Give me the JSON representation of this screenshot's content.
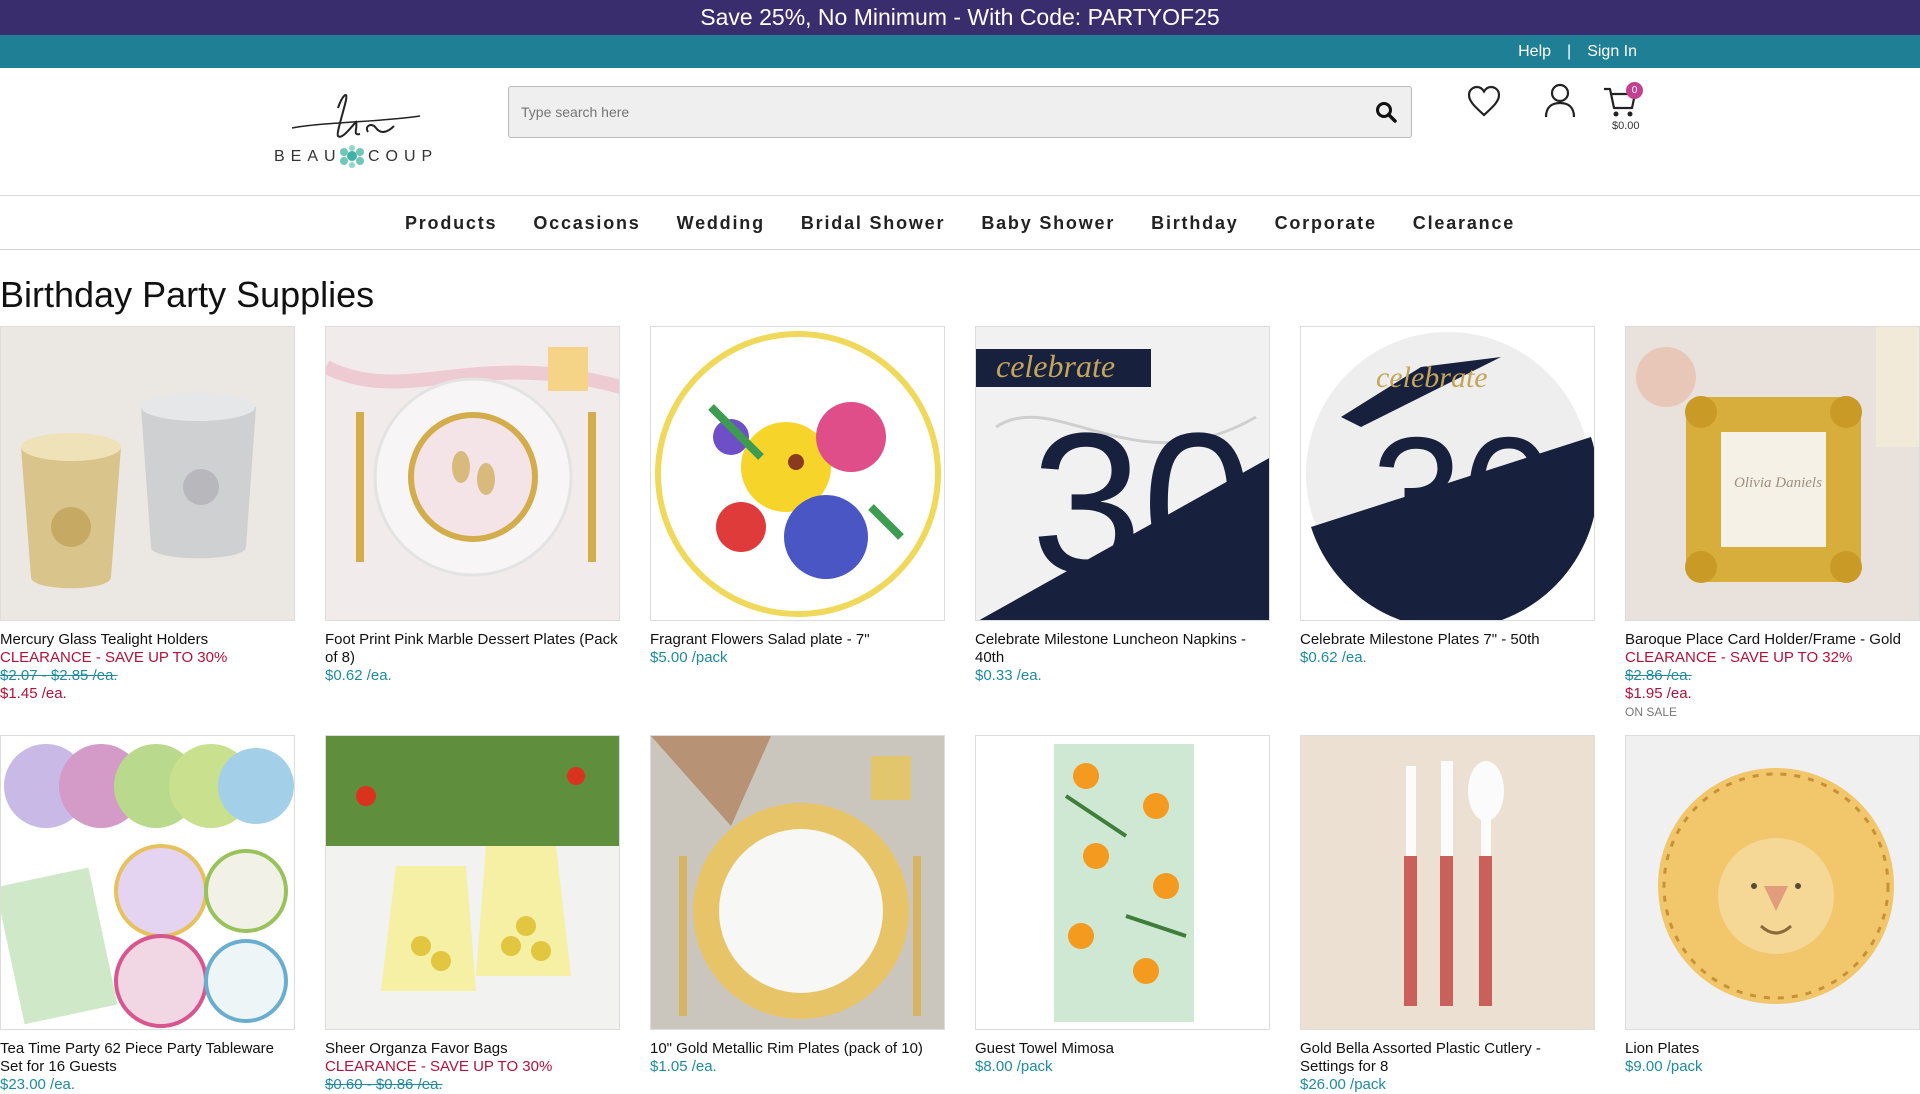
{
  "promo": {
    "text": "Save 25%, No Minimum - With Code: PARTYOF25"
  },
  "utility": {
    "help": "Help",
    "separator": "|",
    "sign_in": "Sign In"
  },
  "logo": {
    "monogram": "bc",
    "wordmark_left": "BEAU",
    "wordmark_right": "COUP"
  },
  "search": {
    "placeholder": "Type search here"
  },
  "cart": {
    "count": "0",
    "total": "$0.00"
  },
  "nav": [
    "Products",
    "Occasions",
    "Wedding",
    "Bridal Shower",
    "Baby Shower",
    "Birthday",
    "Corporate",
    "Clearance"
  ],
  "page_title": "Birthday Party Supplies",
  "products": [
    {
      "name": "Mercury Glass Tealight Holders",
      "clearance": "CLEARANCE - SAVE UP TO 30%",
      "old_price": "$2.07 - $2.85 /ea.",
      "price": "$1.45 /ea.",
      "sale": true
    },
    {
      "name": "Foot Print Pink Marble Dessert Plates (Pack of 8)",
      "price": "$0.62 /ea."
    },
    {
      "name": "Fragrant Flowers Salad plate - 7\"",
      "price": "$5.00 /pack"
    },
    {
      "name": "Celebrate Milestone Luncheon Napkins - 40th",
      "price": "$0.33 /ea."
    },
    {
      "name": "Celebrate Milestone Plates 7\" - 50th",
      "price": "$0.62 /ea."
    },
    {
      "name": "Baroque Place Card Holder/Frame - Gold",
      "clearance": "CLEARANCE - SAVE UP TO 32%",
      "old_price": "$2.86 /ea.",
      "price": "$1.95 /ea.",
      "sale": true,
      "on_sale": "ON SALE"
    },
    {
      "name": "Tea Time Party 62 Piece Party Tableware Set for 16 Guests",
      "price": "$23.00 /ea."
    },
    {
      "name": "Sheer Organza Favor Bags",
      "clearance": "CLEARANCE - SAVE UP TO 30%",
      "old_price": "$0.60 - $0.86 /ea.",
      "sale": true
    },
    {
      "name": "10\" Gold Metallic Rim Plates (pack of 10)",
      "price": "$1.05 /ea."
    },
    {
      "name": "Guest Towel Mimosa",
      "price": "$8.00 /pack"
    },
    {
      "name": "Gold Bella Assorted Plastic Cutlery - Settings for 8",
      "price": "$26.00 /pack"
    },
    {
      "name": "Lion Plates",
      "price": "$9.00 /pack"
    }
  ],
  "image_text": {
    "celebrate": "celebrate",
    "milestone_40": "30",
    "milestone_50": "30",
    "frame_name": "Olivia Daniels"
  },
  "colors": {
    "promo_bg": "#3a2d6e",
    "utility_bg": "#1f7f94",
    "price": "#1f8aa0",
    "clearance": "#b2123a",
    "cart_badge": "#c2408f"
  }
}
